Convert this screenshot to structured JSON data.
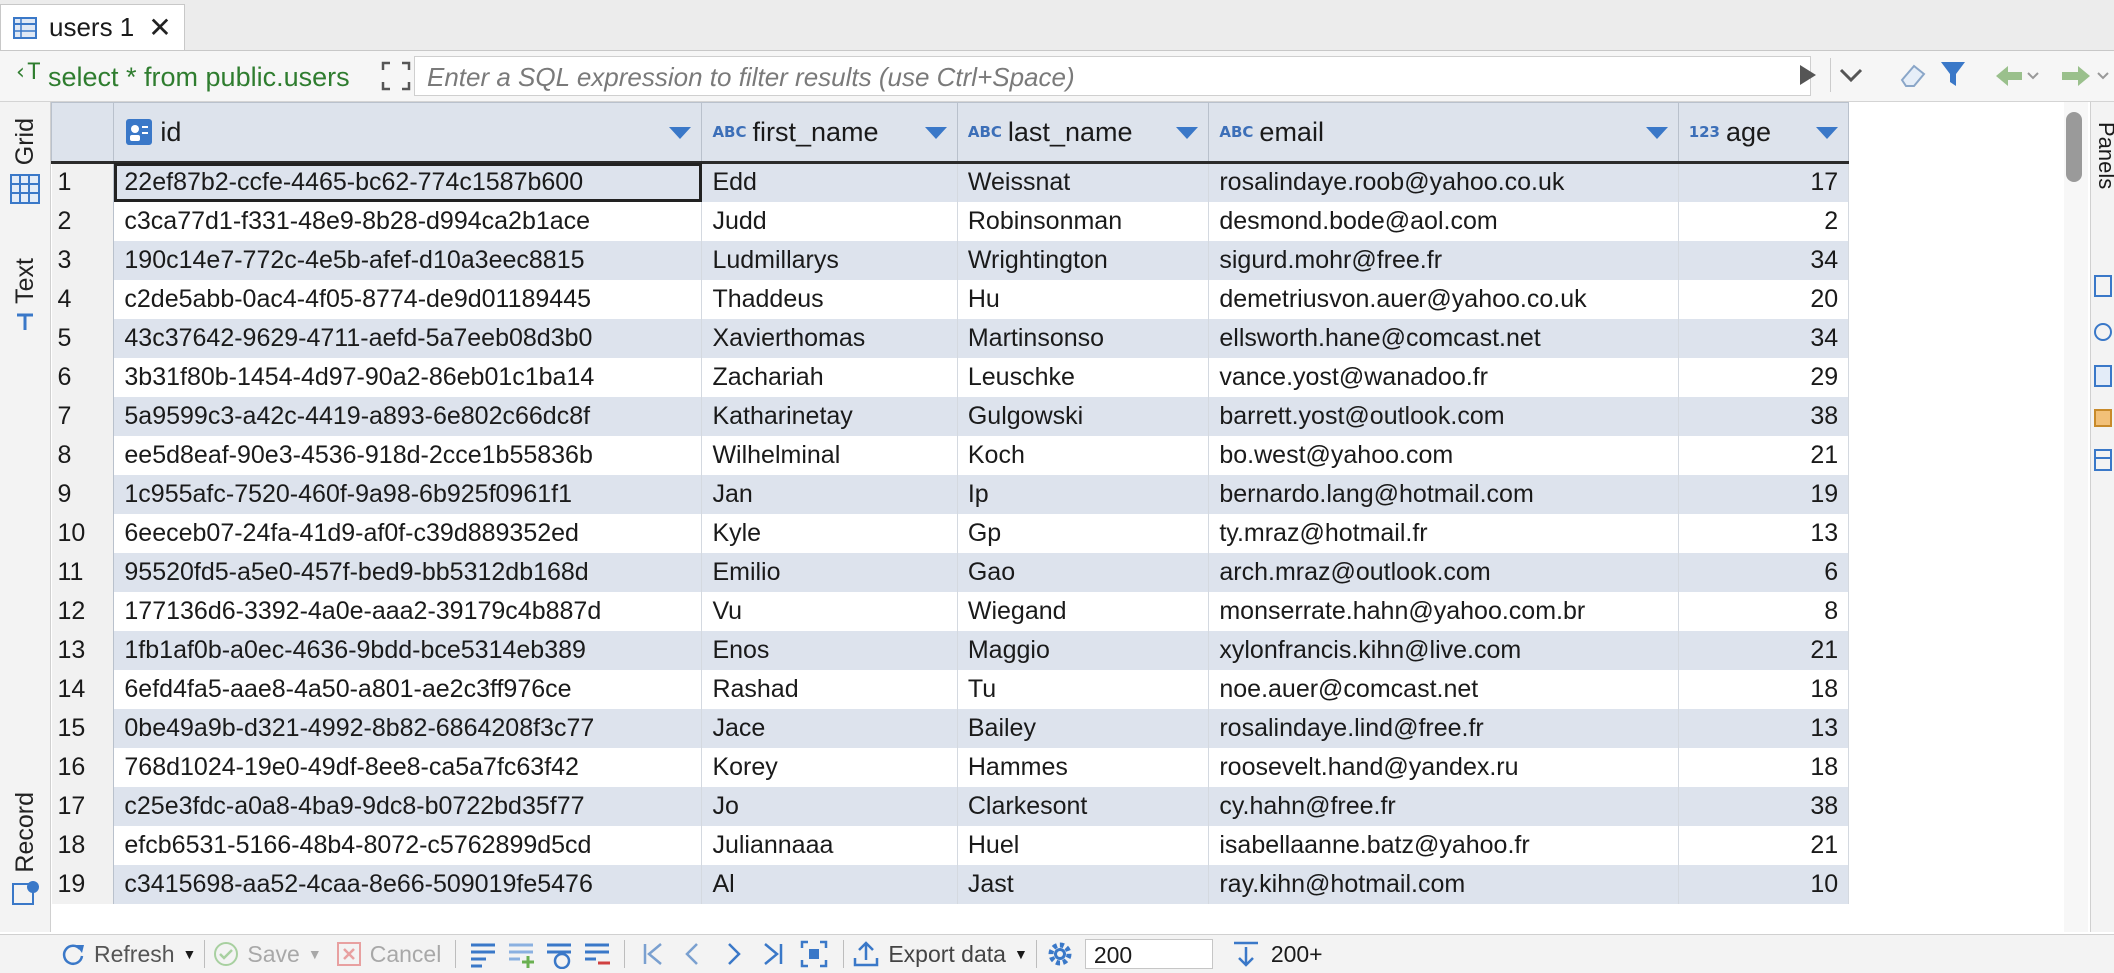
{
  "tab": {
    "title": "users 1",
    "close_glyph": "✕"
  },
  "filter": {
    "sql": "select * from public.users",
    "placeholder": "Enter a SQL expression to filter results (use Ctrl+Space)"
  },
  "sidebar": {
    "grid_label": "Grid",
    "text_label": "Text",
    "record_label": "Record"
  },
  "right_panel": {
    "label": "Panels"
  },
  "columns": [
    {
      "name": "id",
      "type_badge": ""
    },
    {
      "name": "first_name",
      "type_badge": "ABC"
    },
    {
      "name": "last_name",
      "type_badge": "ABC"
    },
    {
      "name": "email",
      "type_badge": "ABC"
    },
    {
      "name": "age",
      "type_badge": "123"
    }
  ],
  "rows": [
    {
      "num": "1",
      "id": "22ef87b2-ccfe-4465-bc62-774c1587b600",
      "first_name": "Edd",
      "last_name": "Weissnat",
      "email": "rosalindaye.roob@yahoo.co.uk",
      "age": "17"
    },
    {
      "num": "2",
      "id": "c3ca77d1-f331-48e9-8b28-d994ca2b1ace",
      "first_name": "Judd",
      "last_name": "Robinsonman",
      "email": "desmond.bode@aol.com",
      "age": "2"
    },
    {
      "num": "3",
      "id": "190c14e7-772c-4e5b-afef-d10a3eec8815",
      "first_name": "Ludmillarys",
      "last_name": "Wrightington",
      "email": "sigurd.mohr@free.fr",
      "age": "34"
    },
    {
      "num": "4",
      "id": "c2de5abb-0ac4-4f05-8774-de9d01189445",
      "first_name": "Thaddeus",
      "last_name": "Hu",
      "email": "demetriusvon.auer@yahoo.co.uk",
      "age": "20"
    },
    {
      "num": "5",
      "id": "43c37642-9629-4711-aefd-5a7eeb08d3b0",
      "first_name": "Xavierthomas",
      "last_name": "Martinsonso",
      "email": "ellsworth.hane@comcast.net",
      "age": "34"
    },
    {
      "num": "6",
      "id": "3b31f80b-1454-4d97-90a2-86eb01c1ba14",
      "first_name": "Zachariah",
      "last_name": "Leuschke",
      "email": "vance.yost@wanadoo.fr",
      "age": "29"
    },
    {
      "num": "7",
      "id": "5a9599c3-a42c-4419-a893-6e802c66dc8f",
      "first_name": "Katharinetay",
      "last_name": "Gulgowski",
      "email": "barrett.yost@outlook.com",
      "age": "38"
    },
    {
      "num": "8",
      "id": "ee5d8eaf-90e3-4536-918d-2cce1b55836b",
      "first_name": "Wilhelminal",
      "last_name": "Koch",
      "email": "bo.west@yahoo.com",
      "age": "21"
    },
    {
      "num": "9",
      "id": "1c955afc-7520-460f-9a98-6b925f0961f1",
      "first_name": "Jan",
      "last_name": "Ip",
      "email": "bernardo.lang@hotmail.com",
      "age": "19"
    },
    {
      "num": "10",
      "id": "6eeceb07-24fa-41d9-af0f-c39d889352ed",
      "first_name": "Kyle",
      "last_name": "Gp",
      "email": "ty.mraz@hotmail.fr",
      "age": "13"
    },
    {
      "num": "11",
      "id": "95520fd5-a5e0-457f-bed9-bb5312db168d",
      "first_name": "Emilio",
      "last_name": "Gao",
      "email": "arch.mraz@outlook.com",
      "age": "6"
    },
    {
      "num": "12",
      "id": "177136d6-3392-4a0e-aaa2-39179c4b887d",
      "first_name": "Vu",
      "last_name": "Wiegand",
      "email": "monserrate.hahn@yahoo.com.br",
      "age": "8"
    },
    {
      "num": "13",
      "id": "1fb1af0b-a0ec-4636-9bdd-bce5314eb389",
      "first_name": "Enos",
      "last_name": "Maggio",
      "email": "xylonfrancis.kihn@live.com",
      "age": "21"
    },
    {
      "num": "14",
      "id": "6efd4fa5-aae8-4a50-a801-ae2c3ff976ce",
      "first_name": "Rashad",
      "last_name": "Tu",
      "email": "noe.auer@comcast.net",
      "age": "18"
    },
    {
      "num": "15",
      "id": "0be49a9b-d321-4992-8b82-6864208f3c77",
      "first_name": "Jace",
      "last_name": "Bailey",
      "email": "rosalindaye.lind@free.fr",
      "age": "13"
    },
    {
      "num": "16",
      "id": "768d1024-19e0-49df-8ee8-ca5a7fc63f42",
      "first_name": "Korey",
      "last_name": "Hammes",
      "email": "roosevelt.hand@yandex.ru",
      "age": "18"
    },
    {
      "num": "17",
      "id": "c25e3fdc-a0a8-4ba9-9dc8-b0722bd35f77",
      "first_name": "Jo",
      "last_name": "Clarkesont",
      "email": "cy.hahn@free.fr",
      "age": "38"
    },
    {
      "num": "18",
      "id": "efcb6531-5166-48b4-8072-c5762899d5cd",
      "first_name": "Juliannaaa",
      "last_name": "Huel",
      "email": "isabellaanne.batz@yahoo.fr",
      "age": "21"
    },
    {
      "num": "19",
      "id": "c3415698-aa52-4caa-8e66-509019fe5476",
      "first_name": "Al",
      "last_name": "Jast",
      "email": "ray.kihn@hotmail.com",
      "age": "10"
    }
  ],
  "toolbar": {
    "refresh_label": "Refresh",
    "save_label": "Save",
    "cancel_label": "Cancel",
    "export_label": "Export data",
    "page_size": "200",
    "row_count": "200+"
  },
  "colors": {
    "sql_green": "#2f7d2f",
    "header_bg": "#dde3ec",
    "stripe": "#dde3ed",
    "accent_blue": "#3a78c8"
  }
}
